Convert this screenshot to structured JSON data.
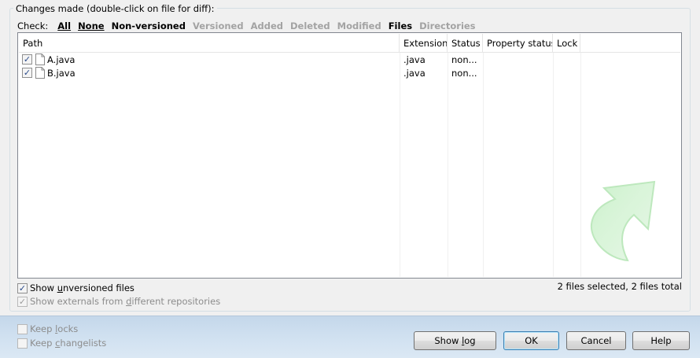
{
  "group": {
    "title": "Changes made (double-click on file for diff):"
  },
  "check_bar": {
    "label": "Check:",
    "links": [
      {
        "label": "All",
        "enabled": true
      },
      {
        "label": "None",
        "enabled": true
      },
      {
        "label": "Non-versioned",
        "enabled": true
      },
      {
        "label": "Versioned",
        "enabled": false
      },
      {
        "label": "Added",
        "enabled": false
      },
      {
        "label": "Deleted",
        "enabled": false
      },
      {
        "label": "Modified",
        "enabled": false
      },
      {
        "label": "Files",
        "enabled": true
      },
      {
        "label": "Directories",
        "enabled": false
      }
    ]
  },
  "table": {
    "columns": [
      "Path",
      "Extension",
      "Status",
      "Property status",
      "Lock"
    ],
    "rows": [
      {
        "checked": true,
        "path": "A.java",
        "extension": ".java",
        "status": "non..."
      },
      {
        "checked": true,
        "path": "B.java",
        "extension": ".java",
        "status": "non..."
      }
    ]
  },
  "options": {
    "show_unversioned": {
      "pre": "Show ",
      "key": "u",
      "post": "nversioned files",
      "checked": true
    },
    "show_externals": {
      "pre": "Show externals from ",
      "key": "d",
      "post": "ifferent repositories",
      "checked": true,
      "enabled": false
    }
  },
  "summary": "2 files selected, 2 files total",
  "footer": {
    "keep_locks": {
      "pre": "Keep ",
      "key": "l",
      "post": "ocks",
      "checked": false
    },
    "keep_changelists": {
      "pre": "Keep ",
      "key": "c",
      "post": "hangelists",
      "checked": false
    },
    "buttons": {
      "show_log": {
        "pre": "Show ",
        "key": "l",
        "post": "og"
      },
      "ok": "OK",
      "cancel": "Cancel",
      "help": "Help"
    }
  },
  "colors": {
    "disabled_text": "#a3a3a3",
    "arrow_green": "#7dd67d",
    "footer_gradient": "#cfe0f0"
  }
}
